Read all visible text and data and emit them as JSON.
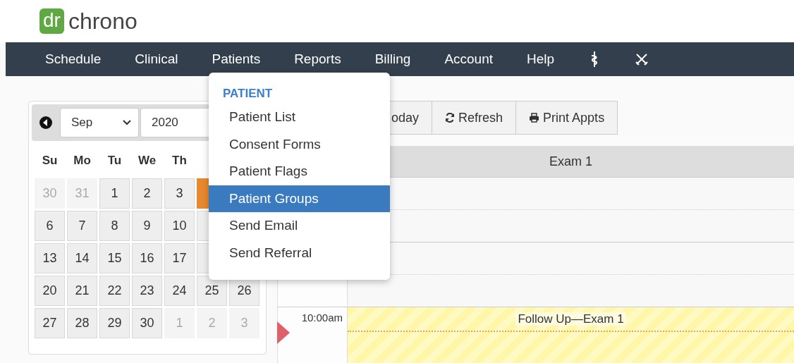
{
  "logo": {
    "badge": "dr",
    "name": "chrono"
  },
  "nav": {
    "items": [
      {
        "label": "Schedule"
      },
      {
        "label": "Clinical"
      },
      {
        "label": "Patients"
      },
      {
        "label": "Reports"
      },
      {
        "label": "Billing"
      },
      {
        "label": "Account"
      },
      {
        "label": "Help"
      }
    ]
  },
  "calendar": {
    "month": "Sep",
    "year": "2020",
    "weekdays": [
      "Su",
      "Mo",
      "Tu",
      "We",
      "Th"
    ],
    "weeks": [
      [
        {
          "day": "30",
          "muted": true,
          "selected": false
        },
        {
          "day": "31",
          "muted": true,
          "selected": false
        },
        {
          "day": "1",
          "muted": false,
          "selected": false
        },
        {
          "day": "2",
          "muted": false,
          "selected": false
        },
        {
          "day": "3",
          "muted": false,
          "selected": false
        },
        {
          "muted": false,
          "selected": true
        }
      ],
      [
        {
          "day": "6",
          "muted": false,
          "selected": false
        },
        {
          "day": "7",
          "muted": false,
          "selected": false
        },
        {
          "day": "8",
          "muted": false,
          "selected": false
        },
        {
          "day": "9",
          "muted": false,
          "selected": false
        },
        {
          "day": "10",
          "muted": false,
          "selected": false
        }
      ],
      [
        {
          "day": "13",
          "muted": false,
          "selected": false
        },
        {
          "day": "14",
          "muted": false,
          "selected": false
        },
        {
          "day": "15",
          "muted": false,
          "selected": false
        },
        {
          "day": "16",
          "muted": false,
          "selected": false
        },
        {
          "day": "17",
          "muted": false,
          "selected": false
        }
      ],
      [
        {
          "day": "20",
          "muted": false,
          "selected": false
        },
        {
          "day": "21",
          "muted": false,
          "selected": false
        },
        {
          "day": "22",
          "muted": false,
          "selected": false
        },
        {
          "day": "23",
          "muted": false,
          "selected": false
        },
        {
          "day": "24",
          "muted": false,
          "selected": false
        },
        {
          "day": "25",
          "muted": false,
          "selected": false
        },
        {
          "day": "26",
          "muted": false,
          "selected": false
        }
      ],
      [
        {
          "day": "27",
          "muted": false,
          "selected": false
        },
        {
          "day": "28",
          "muted": false,
          "selected": false
        },
        {
          "day": "29",
          "muted": false,
          "selected": false
        },
        {
          "day": "30",
          "muted": false,
          "selected": false
        },
        {
          "day": "1",
          "muted": true,
          "selected": false
        },
        {
          "day": "2",
          "muted": true,
          "selected": false
        },
        {
          "day": "3",
          "muted": true,
          "selected": false
        }
      ]
    ]
  },
  "toolbar": [
    {
      "label": "oday",
      "kind": "today"
    },
    {
      "label": "Refresh",
      "kind": "refresh"
    },
    {
      "label": "Print Appts",
      "kind": "print"
    }
  ],
  "schedule": {
    "column": "Exam 1",
    "time": "10:00am",
    "appointment": "Follow Up—Exam 1"
  },
  "menu": {
    "heading": "PATIENT",
    "items": [
      {
        "label": "Patient List",
        "selected": false
      },
      {
        "label": "Consent Forms",
        "selected": false
      },
      {
        "label": "Patient Flags",
        "selected": false
      },
      {
        "label": "Patient Groups",
        "selected": true
      },
      {
        "label": "Send Email",
        "selected": false
      },
      {
        "label": "Send Referral",
        "selected": false
      }
    ]
  }
}
